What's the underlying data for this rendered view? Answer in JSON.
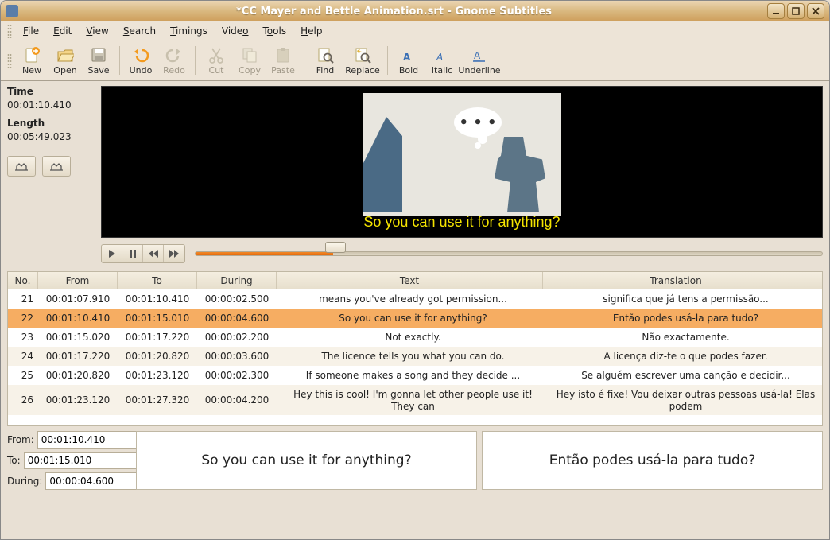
{
  "window": {
    "title": "*CC Mayer and Bettle Animation.srt - Gnome Subtitles"
  },
  "menu": [
    "File",
    "Edit",
    "View",
    "Search",
    "Timings",
    "Video",
    "Tools",
    "Help"
  ],
  "toolbar": {
    "new": "New",
    "open": "Open",
    "save": "Save",
    "undo": "Undo",
    "redo": "Redo",
    "cut": "Cut",
    "copy": "Copy",
    "paste": "Paste",
    "find": "Find",
    "replace": "Replace",
    "bold": "Bold",
    "italic": "Italic",
    "underline": "Underline"
  },
  "info": {
    "time_label": "Time",
    "time_value": "00:01:10.410",
    "length_label": "Length",
    "length_value": "00:05:49.023"
  },
  "video": {
    "subtitle": "So you can use it for anything?"
  },
  "columns": {
    "no": "No.",
    "from": "From",
    "to": "To",
    "during": "During",
    "text": "Text",
    "translation": "Translation"
  },
  "rows": [
    {
      "no": "21",
      "from": "00:01:07.910",
      "to": "00:01:10.410",
      "dur": "00:00:02.500",
      "text": "means you've already got permission...",
      "trans": "significa que já tens a permissão..."
    },
    {
      "no": "22",
      "from": "00:01:10.410",
      "to": "00:01:15.010",
      "dur": "00:00:04.600",
      "text": "So you can use it for anything?",
      "trans": "Então podes usá-la para tudo?",
      "selected": true
    },
    {
      "no": "23",
      "from": "00:01:15.020",
      "to": "00:01:17.220",
      "dur": "00:00:02.200",
      "text": "Not exactly.",
      "trans": "Não exactamente."
    },
    {
      "no": "24",
      "from": "00:01:17.220",
      "to": "00:01:20.820",
      "dur": "00:00:03.600",
      "text": "The licence tells you what you can do.",
      "trans": "A licença diz-te o que podes fazer."
    },
    {
      "no": "25",
      "from": "00:01:20.820",
      "to": "00:01:23.120",
      "dur": "00:00:02.300",
      "text": "If someone makes a song and they decide ...",
      "trans": "Se alguém escrever uma canção e decidir..."
    },
    {
      "no": "26",
      "from": "00:01:23.120",
      "to": "00:01:27.320",
      "dur": "00:00:04.200",
      "text": "Hey this is cool! I'm gonna let other people use it! They can",
      "trans": "Hey isto é fixe! Vou deixar outras pessoas usá-la! Elas podem",
      "wrap": true
    }
  ],
  "edit": {
    "from_label": "From:",
    "from_value": "00:01:10.410",
    "to_label": "To:",
    "to_value": "00:01:15.010",
    "during_label": "During:",
    "during_value": "00:00:04.600",
    "text": "So you can use it for anything?",
    "translation": "Então podes usá-la para tudo?"
  }
}
